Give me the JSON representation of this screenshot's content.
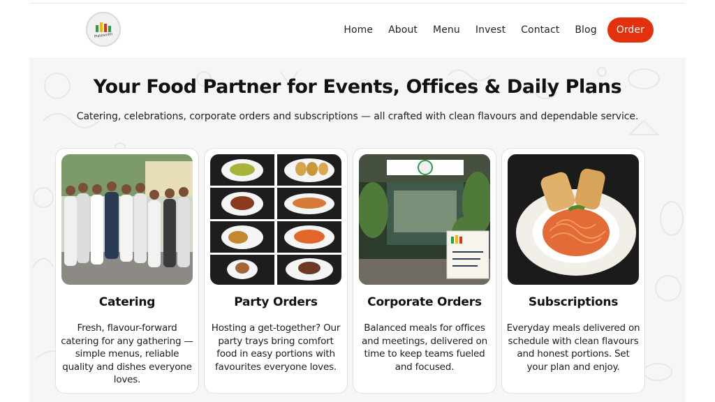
{
  "brand": {
    "name": "Platesmith",
    "logo_colors": [
      "#2a9d46",
      "#f2b705",
      "#e2310c"
    ]
  },
  "nav": {
    "items": [
      {
        "label": "Home"
      },
      {
        "label": "About"
      },
      {
        "label": "Menu"
      },
      {
        "label": "Invest"
      },
      {
        "label": "Contact"
      },
      {
        "label": "Blog"
      }
    ],
    "order_label": "Order",
    "accent": "#e2310c"
  },
  "hero": {
    "title": "Your Food Partner for Events, Offices & Daily Plans",
    "subtitle": "Catering, celebrations, corporate orders and subscriptions — all crafted with clean flavours and dependable service."
  },
  "cards": [
    {
      "title": "Catering",
      "text": "Fresh, flavour-forward catering for any gathering — simple menus, reliable quality and dishes everyone loves."
    },
    {
      "title": "Party Orders",
      "text": "Hosting a get-together? Our party trays bring comfort food in easy portions with favourites everyone loves."
    },
    {
      "title": "Corporate Orders",
      "text": "Balanced meals for offices and meetings, delivered on time to keep teams fueled and focused."
    },
    {
      "title": "Subscriptions",
      "text": "Everyday meals delivered on schedule with clean flavours and honest portions. Set your plan and enjoy."
    }
  ]
}
